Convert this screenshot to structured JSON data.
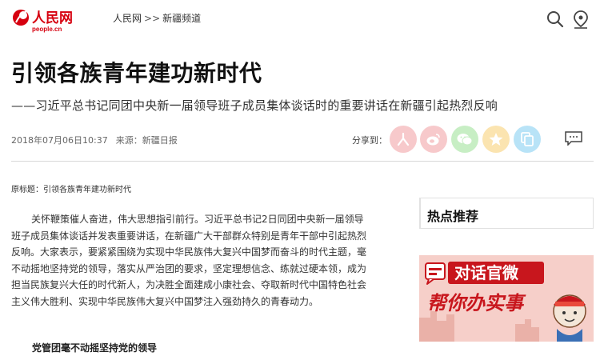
{
  "header": {
    "logo_text": "人民网",
    "logo_sub": "people.cn",
    "breadcrumb_home": "人民网",
    "breadcrumb_sep": ">>",
    "breadcrumb_channel": "新疆频道"
  },
  "article": {
    "title": "引领各族青年建功新时代",
    "subtitle": "——习近平总书记同团中央新一届领导班子成员集体谈话时的重要讲话在新疆引起热烈反响",
    "datetime": "2018年07月06日10:37",
    "source": "来源：新疆日报",
    "share_label": "分享到：",
    "original_title": "原标题：引领各族青年建功新时代",
    "paragraph_lines": [
      "关怀鞭策催人奋进，伟大思想指引前行。习近平总书记2日同团中央新一届领导",
      "班子成员集体谈话并发表重要讲话，在新疆广大干部群众特别是青年干部中引起热烈",
      "反响。大家表示，要紧紧围绕为实现中华民族伟大复兴中国梦而奋斗的时代主题，毫",
      "不动摇地坚持党的领导，落实从严治团的要求，坚定理想信念、练就过硬本领，成为",
      "担当民族复兴大任的时代新人，为决胜全面建成小康社会、夺取新时代中国特色社会",
      "主义伟大胜利、实现中华民族伟大复兴中国梦注入强劲持久的青春动力。"
    ],
    "section_heading": "党管团毫不动摇坚持党的领导"
  },
  "sidebar": {
    "hot_title": "热点推荐",
    "banner_line1": "对话官微",
    "banner_line2": "帮你办实事"
  },
  "colors": {
    "brand_red": "#d6000f",
    "banner_red": "#c8161d",
    "banner_bg": "#f6cfc9"
  },
  "icons": [
    "search-icon",
    "location-icon",
    "people-share-icon",
    "weibo-icon",
    "wechat-icon",
    "qzone-icon",
    "copy-icon",
    "comment-icon"
  ]
}
